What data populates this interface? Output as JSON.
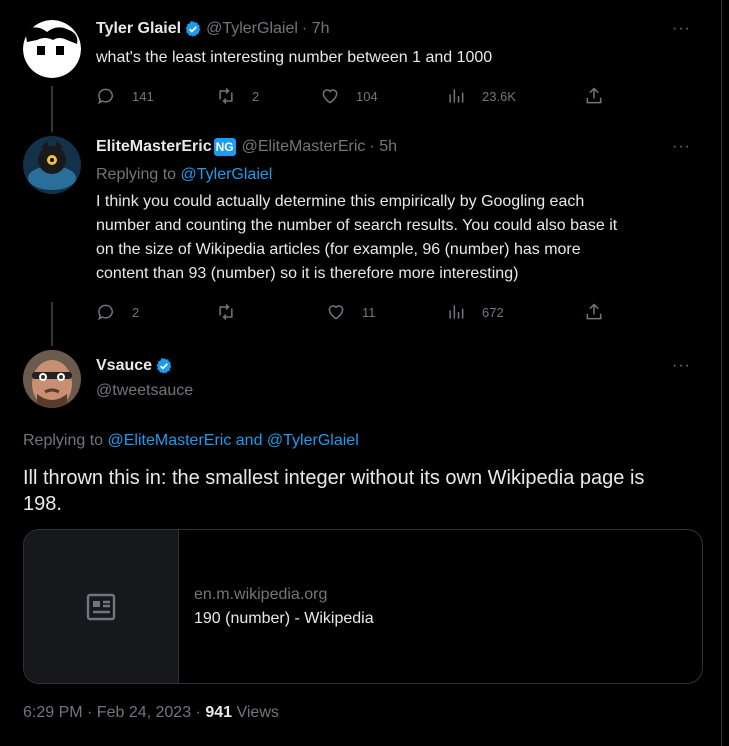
{
  "tweets": [
    {
      "name": "Tyler Glaiel",
      "handle": "@TylerGlaiel",
      "time": "· 7h",
      "text": "what's the least interesting number between 1 and 1000",
      "stats": {
        "replies": "141",
        "retweets": "2",
        "likes": "104",
        "views": "23.6K"
      }
    },
    {
      "name": "EliteMasterEric",
      "badge": "NG",
      "handle": "@EliteMasterEric",
      "time": "· 5h",
      "replying_label": "Replying to ",
      "replying_to": "@TylerGlaiel",
      "text_lines": [
        "I think you could actually determine this empirically by Googling each",
        "number and counting the number of search results. You could also base it",
        "on the size of Wikipedia articles (for example, 96 (number) has more",
        "content than 93 (number) so it is therefore more interesting)"
      ],
      "stats": {
        "replies": "2",
        "retweets": "",
        "likes": "11",
        "views": "672"
      }
    }
  ],
  "main_tweet": {
    "name": "Vsauce",
    "handle": "@tweetsauce",
    "replying_label": "Replying to ",
    "replying_to_1": "@EliteMasterEric",
    "replying_and": " and ",
    "replying_to_2": "@TylerGlaiel",
    "text_lines": [
      "Ill thrown this in: the smallest integer without its own Wikipedia page is",
      "198."
    ],
    "card": {
      "domain": "en.m.wikipedia.org",
      "title": "190 (number) - Wikipedia"
    },
    "timestamp": "6:29 PM · Feb 24, 2023 · ",
    "views_count": "941",
    "views_label": " Views"
  },
  "more_label": "···",
  "colors": {
    "accent": "#1d9bf0",
    "muted": "#71767b",
    "text": "#e7e9ea",
    "background": "#000000"
  }
}
